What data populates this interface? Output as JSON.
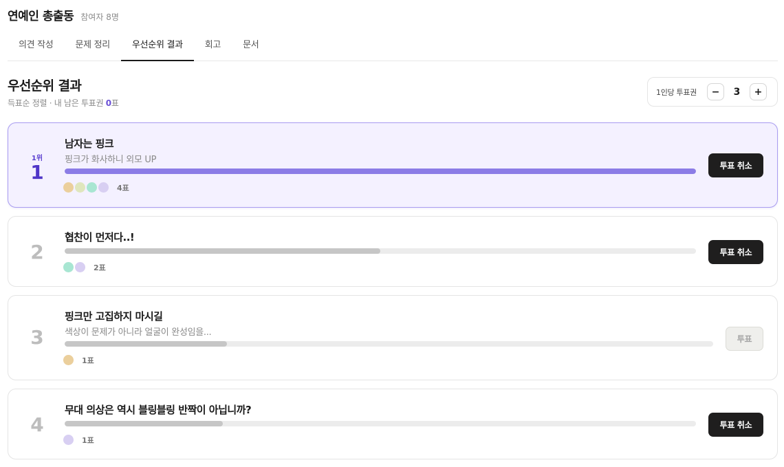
{
  "room": {
    "title": "연예인 총출동",
    "participants": "참여자 8명"
  },
  "tabs": [
    {
      "label": "의견 작성"
    },
    {
      "label": "문제 정리"
    },
    {
      "label": "우선순위 결과"
    },
    {
      "label": "회고"
    },
    {
      "label": "문서"
    }
  ],
  "active_tab": "우선순위 결과",
  "section": {
    "title": "우선순위 결과",
    "sort_text": "득표순 정렬 · 내 남은 투표권",
    "remaining": "0",
    "remaining_unit": "표"
  },
  "votes_per_person": {
    "label": "1인당 투표권",
    "minus": "−",
    "value": "3",
    "plus": "+"
  },
  "colors": {
    "accent": "#5b40d0",
    "first_bg": "#f4f1ff",
    "first_bar": "#8b7ce6",
    "bar": "#c6c6c6",
    "avatar_orange": "#ebcf9c",
    "avatar_green": "#dfe6bd",
    "avatar_mint": "#a8e6d2",
    "avatar_purple": "#d8cff2"
  },
  "items": [
    {
      "rank_small": "1위",
      "rank": "1",
      "name": "남자는 핑크",
      "desc": "핑크가 화사하니 외모 UP",
      "vote_share": 1.0,
      "avatars": [
        "#ebcf9c",
        "#dfe6bd",
        "#a8e6d2",
        "#d8cff2"
      ],
      "votes": "4표",
      "action": "투표 취소"
    },
    {
      "rank_small": "",
      "rank": "2",
      "name": "협찬이 먼저다..!",
      "desc": "",
      "vote_share": 0.5,
      "avatars": [
        "#a8e6d2",
        "#d8cff2"
      ],
      "votes": "2표",
      "action": "투표 취소"
    },
    {
      "rank_small": "",
      "rank": "3",
      "name": "핑크만 고집하지 마시길",
      "desc": "색상이 문제가 아니라 얼굴이 완성임을...",
      "vote_share": 0.25,
      "avatars": [
        "#ebcf9c"
      ],
      "votes": "1표",
      "action": "투표"
    },
    {
      "rank_small": "",
      "rank": "4",
      "name": "무대 의상은 역시 블링블링 반짝이 아닙니까?",
      "desc": "",
      "vote_share": 0.25,
      "avatars": [
        "#d8cff2"
      ],
      "votes": "1표",
      "action": "투표 취소"
    }
  ]
}
